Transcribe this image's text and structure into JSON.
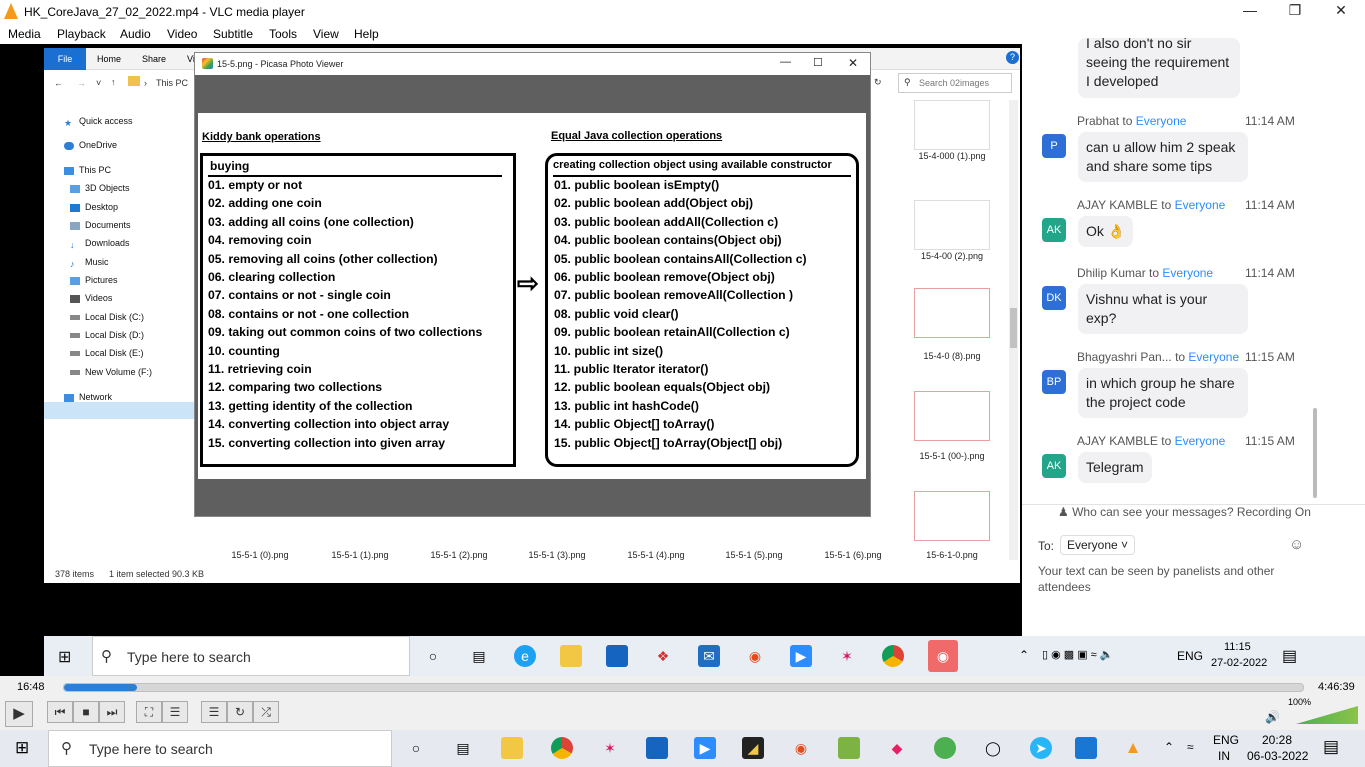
{
  "vlc": {
    "title": "HK_CoreJava_27_02_2022.mp4 - VLC media player",
    "menu": [
      "Media",
      "Playback",
      "Audio",
      "Video",
      "Subtitle",
      "Tools",
      "View",
      "Help"
    ],
    "time_elapsed": "16:48",
    "time_total": "4:46:39",
    "progress_percent": 5.9,
    "volume_label": "100%",
    "volume_percent": 100
  },
  "explorer": {
    "ribbon_tabs": [
      "File",
      "Home",
      "Share",
      "Vi"
    ],
    "breadcrumb": "This PC",
    "search_placeholder": "Search 02images",
    "sidebar": [
      "Quick access",
      "OneDrive",
      "This PC",
      "3D Objects",
      "Desktop",
      "Documents",
      "Downloads",
      "Music",
      "Pictures",
      "Videos",
      "Local Disk (C:)",
      "Local Disk (D:)",
      "Local Disk (E:)",
      "New Volume (F:)",
      "Network"
    ],
    "selected_sidebar": "Local Disk (E:)",
    "right_thumbs": [
      "15-4-000 (1).png",
      "15-4-00 (2).png",
      "15-4-0 (8).png",
      "15-5-1 (00-).png"
    ],
    "right_partial": [
      "ng",
      "ng",
      "ng",
      "ng"
    ],
    "bottom_thumbs": [
      "15-5-1 (0).png",
      "15-5-1 (1).png",
      "15-5-1 (2).png",
      "15-5-1 (3).png",
      "15-5-1 (4).png",
      "15-5-1 (5).png",
      "15-5-1 (6).png",
      "15-6-1-0.png"
    ],
    "status_count": "378 items",
    "status_selected": "1 item selected  90.3 KB"
  },
  "picasa": {
    "title": "15-5.png - Picasa Photo Viewer",
    "left_title": "Kiddy bank operations",
    "left_head": "buying",
    "left_items": [
      "01. empty or not",
      "02. adding one coin",
      "03. adding all coins (one collection)",
      "04. removing coin",
      "05. removing all coins (other collection)",
      "06. clearing collection",
      "07. contains or not - single coin",
      "08. contains or not - one collection",
      "09. taking out common coins of two collections",
      "10. counting",
      "11. retrieving coin",
      "12. comparing two collections",
      "13. getting identity of the collection",
      "14. converting collection into object array",
      "15. converting collection into given array"
    ],
    "right_title": "Equal Java collection operations",
    "right_head": "creating collection object using available constructor",
    "right_items": [
      "01. public boolean isEmpty()",
      "02. public boolean add(Object obj)",
      "03. public boolean addAll(Collection c)",
      "04. public boolean contains(Object obj)",
      "05. public boolean containsAll(Collection c)",
      "06. public boolean remove(Object obj)",
      "07. public boolean removeAll(Collection )",
      "08. public void clear()",
      "09. public boolean retainAll(Collection c)",
      "10. public int size()",
      "11. public Iterator iterator()",
      "12. public boolean equals(Object obj)",
      "13. public int hashCode()",
      "14. public Object[] toArray()",
      "15. public Object[] toArray(Object[] obj)"
    ]
  },
  "chat": {
    "partial_bubble": "I also don't no sir seeing the requirement I developed",
    "messages": [
      {
        "sender": "Prabhat",
        "to": "Everyone",
        "time": "11:14 AM",
        "initials": "P",
        "color": "#2d6fd6",
        "text": "can u allow him 2 speak and share some tips"
      },
      {
        "sender": "AJAY KAMBLE",
        "to": "Everyone",
        "time": "11:14 AM",
        "initials": "AK",
        "color": "#23a58a",
        "text": "Ok 👌"
      },
      {
        "sender": "Dhilip Kumar",
        "to": "Everyone",
        "time": "11:14 AM",
        "initials": "DK",
        "color": "#2d6fd6",
        "text": "Vishnu what is your exp?"
      },
      {
        "sender": "Bhagyashri Pan...",
        "to": "Everyone",
        "time": "11:15 AM",
        "initials": "BP",
        "color": "#2d6fd6",
        "text": "in which group he share the project code"
      },
      {
        "sender": "AJAY KAMBLE",
        "to": "Everyone",
        "time": "11:15 AM",
        "initials": "AK",
        "color": "#23a58a",
        "text": "Telegram"
      }
    ],
    "privacy_note": "Who can see your messages? Recording On",
    "to_label": "To:",
    "to_value": "Everyone",
    "input_placeholder": "Your text can be seen by panelists and other attendees"
  },
  "inner_taskbar": {
    "search": "Type here to search",
    "lang": "ENG",
    "time": "11:15",
    "date": "27-02-2022"
  },
  "outer_taskbar": {
    "search": "Type here to search",
    "lang": "ENG",
    "region": "IN",
    "time": "20:28",
    "date": "06-03-2022"
  }
}
